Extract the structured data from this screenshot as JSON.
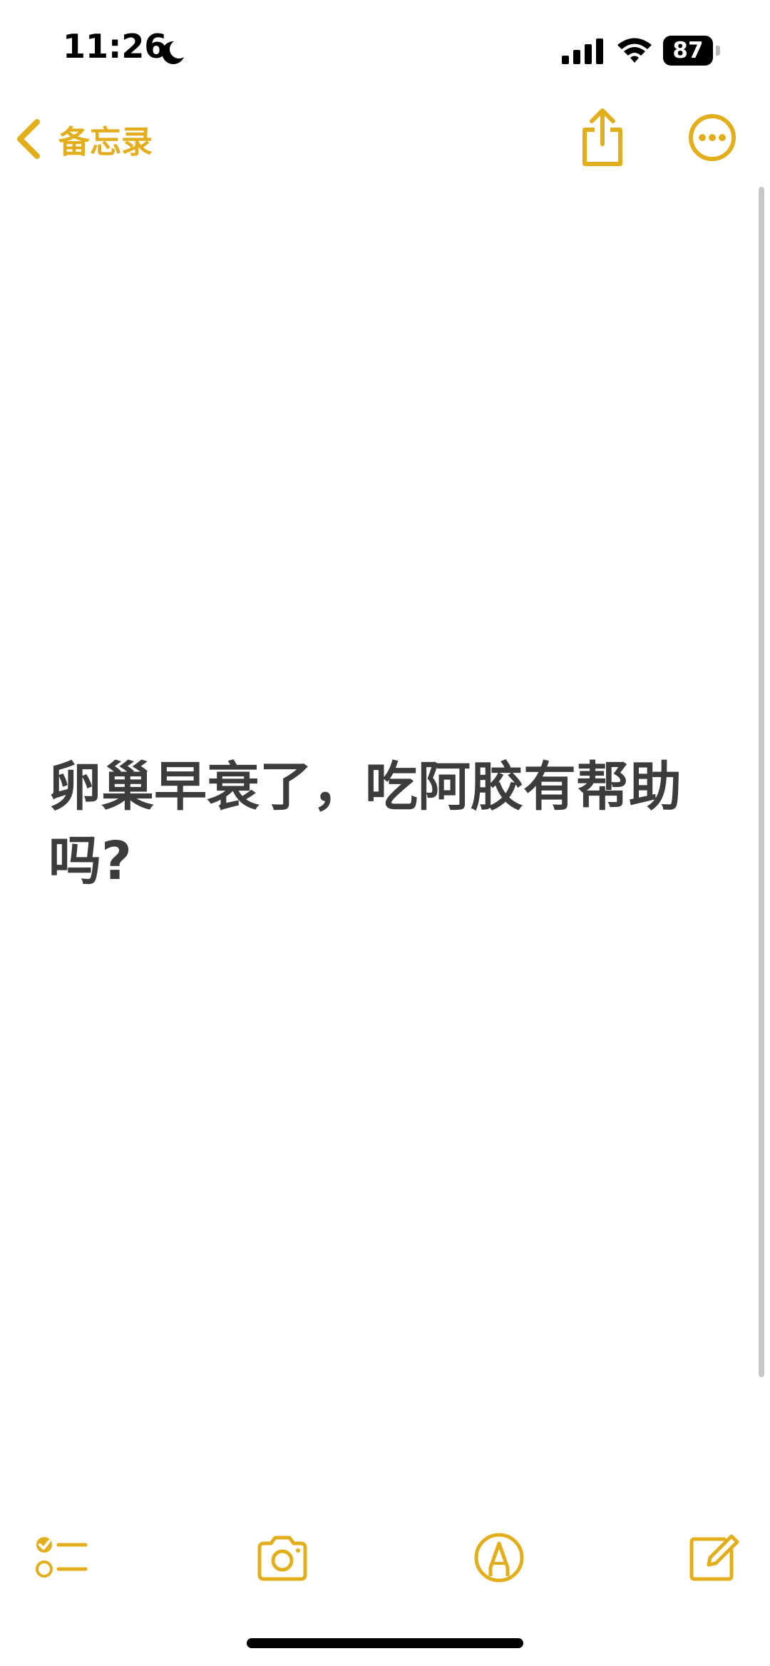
{
  "status_bar": {
    "time": "11:26",
    "battery_level": "87",
    "focus_icon": "moon-icon",
    "signal_icon": "cellular-signal-icon",
    "wifi_icon": "wifi-icon"
  },
  "nav": {
    "back_label": "备忘录",
    "back_icon": "chevron-left-icon",
    "share_icon": "share-icon",
    "more_icon": "ellipsis-circle-icon"
  },
  "note": {
    "text": "卵巢早衰了，吃阿胶有帮助吗?"
  },
  "toolbar": {
    "checklist_icon": "checklist-icon",
    "camera_icon": "camera-icon",
    "markup_icon": "markup-pen-icon",
    "compose_icon": "compose-icon"
  },
  "colors": {
    "accent": "#e3ae1c",
    "text": "#3c3c3c",
    "background": "#ffffff"
  }
}
